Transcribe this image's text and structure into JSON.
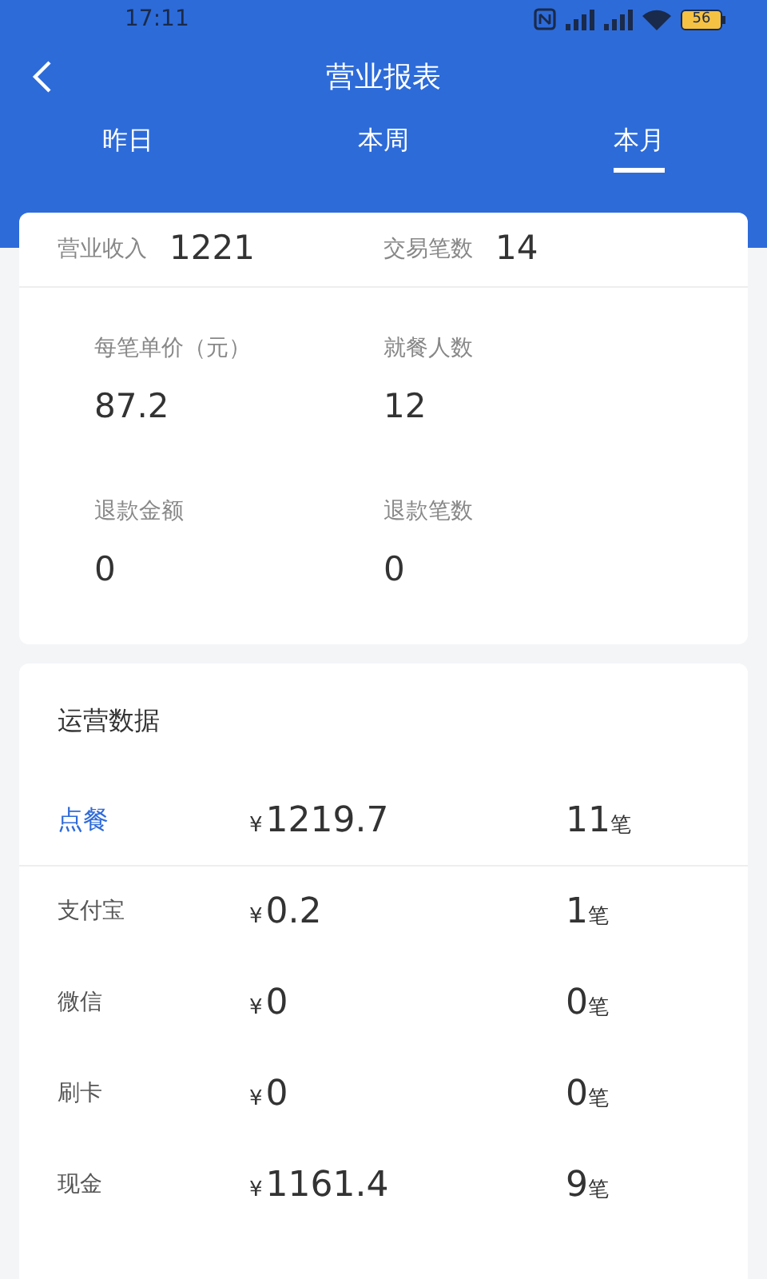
{
  "status_bar": {
    "time": "17:11",
    "battery": "56"
  },
  "header": {
    "title": "营业报表"
  },
  "tabs": [
    {
      "label": "昨日",
      "selected": false
    },
    {
      "label": "本周",
      "selected": false
    },
    {
      "label": "本月",
      "selected": true
    }
  ],
  "summary": [
    {
      "label": "营业收入",
      "value": "1221"
    },
    {
      "label": "交易笔数",
      "value": "14"
    }
  ],
  "stats": [
    {
      "label": "每笔单价（元）",
      "value": "87.2"
    },
    {
      "label": "就餐人数",
      "value": "12"
    },
    {
      "label": "退款金额",
      "value": "0"
    },
    {
      "label": "退款笔数",
      "value": "0"
    }
  ],
  "operations": {
    "title": "运营数据",
    "rows": [
      {
        "kind": "header",
        "name": "点餐",
        "currency": "¥",
        "amount": "1219.7",
        "count": "11",
        "unit": "笔"
      },
      {
        "kind": "channel",
        "name": "支付宝",
        "currency": "¥",
        "amount": "0.2",
        "count": "1",
        "unit": "笔"
      },
      {
        "kind": "channel",
        "name": "微信",
        "currency": "¥",
        "amount": "0",
        "count": "0",
        "unit": "笔"
      },
      {
        "kind": "channel",
        "name": "刷卡",
        "currency": "¥",
        "amount": "0",
        "count": "0",
        "unit": "笔"
      },
      {
        "kind": "channel",
        "name": "现金",
        "currency": "¥",
        "amount": "1161.4",
        "count": "9",
        "unit": "笔"
      }
    ]
  }
}
